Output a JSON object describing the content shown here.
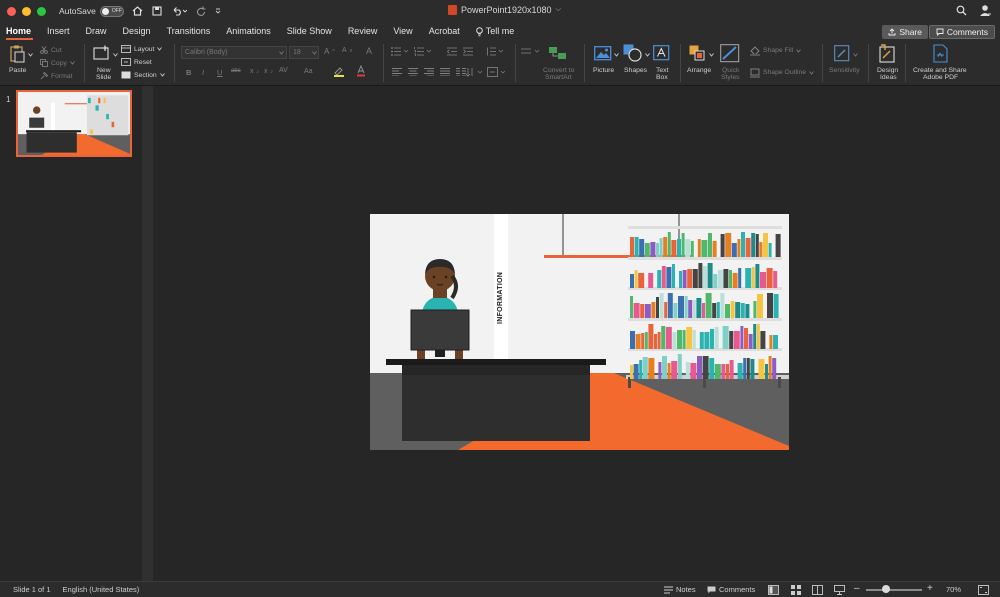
{
  "titlebar": {
    "autosave_label": "AutoSave",
    "autosave_state": "OFF",
    "document_title": "PowerPoint1920x1080",
    "title_chevron": "⌵"
  },
  "tabs": [
    {
      "label": "Home",
      "active": true
    },
    {
      "label": "Insert"
    },
    {
      "label": "Draw"
    },
    {
      "label": "Design"
    },
    {
      "label": "Transitions"
    },
    {
      "label": "Animations"
    },
    {
      "label": "Slide Show"
    },
    {
      "label": "Review"
    },
    {
      "label": "View"
    },
    {
      "label": "Acrobat"
    },
    {
      "label": "Tell me"
    }
  ],
  "share": {
    "label": "Share"
  },
  "comments": {
    "label": "Comments"
  },
  "ribbon": {
    "paste": "Paste",
    "cut": "Cut",
    "copy": "Copy",
    "format": "Format",
    "new_slide_1": "New",
    "new_slide_2": "Slide",
    "layout": "Layout",
    "reset": "Reset",
    "section": "Section",
    "font_name": "Calibri (Body)",
    "font_size": "18",
    "bold": "B",
    "italic": "I",
    "underline": "U",
    "strike": "abc",
    "convert_1": "Convert to",
    "convert_2": "SmartArt",
    "picture": "Picture",
    "shapes": "Shapes",
    "textbox_1": "Text",
    "textbox_2": "Box",
    "arrange": "Arrange",
    "quick_1": "Quick",
    "quick_2": "Styles",
    "shape_fill": "Shape Fill",
    "shape_outline": "Shape Outline",
    "sensitivity": "Sensitivity",
    "design_1": "Design",
    "design_2": "Ideas",
    "adobe_1": "Create and Share",
    "adobe_2": "Adobe PDF"
  },
  "thumbnails": [
    {
      "number": "1"
    }
  ],
  "slide": {
    "sign_text": "INFORMATION"
  },
  "status": {
    "slide_of": "Slide 1 of 1",
    "language": "English (United States)",
    "notes": "Notes",
    "comments": "Comments",
    "zoom": "70%",
    "zoom_minus": "–",
    "zoom_plus": "+"
  },
  "colors": {
    "accent": "#e9633b",
    "slide_orange": "#f26a2d",
    "desk": "#2b2b2b",
    "floor": "#5f5f5f"
  }
}
